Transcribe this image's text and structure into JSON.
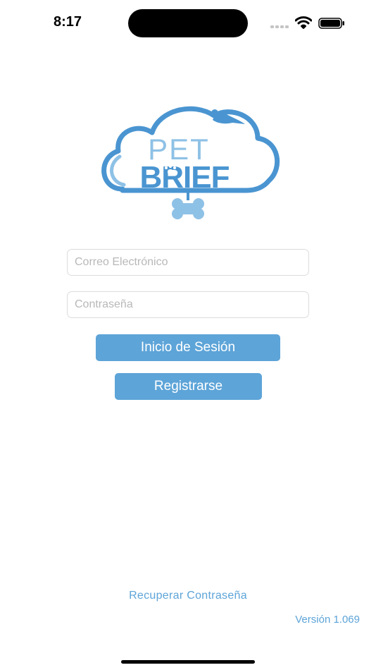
{
  "status_bar": {
    "time": "8:17",
    "icons": [
      "signal-icon",
      "wifi-icon",
      "battery-icon"
    ]
  },
  "logo": {
    "line1": "PET",
    "line2": "BRIEF",
    "icon": "cloud-logo-icon"
  },
  "form": {
    "email_placeholder": "Correo Electrónico",
    "email_value": "",
    "password_placeholder": "Contraseña",
    "password_value": "",
    "login_label": "Inicio de Sesión",
    "register_label": "Registrarse"
  },
  "footer": {
    "recover_label": "Recuperar Contraseña",
    "version": "Versión 1.069"
  },
  "colors": {
    "accent": "#5da4d8",
    "logo_light": "#8ec1e6",
    "logo_dark": "#4a95d1",
    "field_border": "#dcdcdc",
    "placeholder": "#b8b8b8"
  }
}
